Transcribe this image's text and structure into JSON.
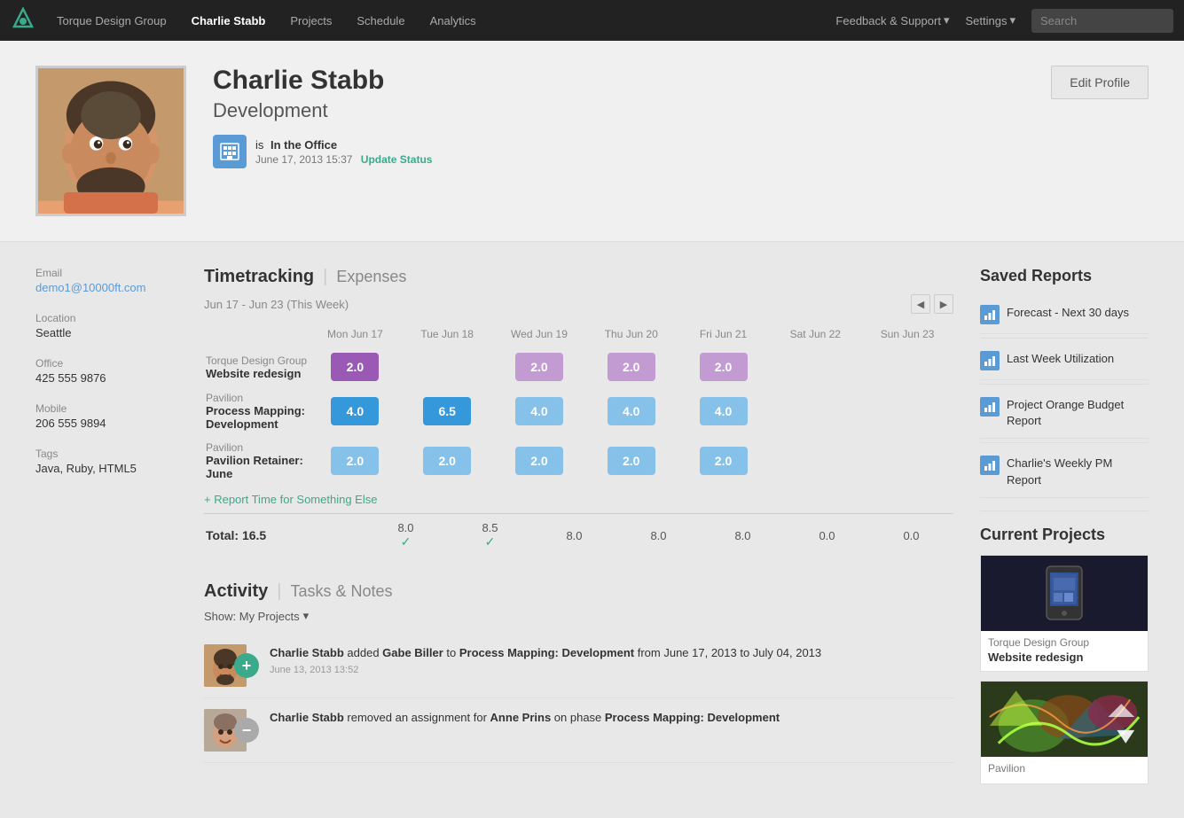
{
  "navbar": {
    "logo_label": "Torque Design Group Logo",
    "brand": "Torque Design Group",
    "nav_items": [
      {
        "label": "Torque Design Group",
        "active": false
      },
      {
        "label": "Charlie Stabb",
        "active": true
      },
      {
        "label": "Projects",
        "active": false
      },
      {
        "label": "Schedule",
        "active": false
      },
      {
        "label": "Analytics",
        "active": false
      }
    ],
    "feedback_label": "Feedback & Support",
    "settings_label": "Settings",
    "search_placeholder": "Search"
  },
  "profile": {
    "name": "Charlie Stabb",
    "department": "Development",
    "status_label": "is",
    "status": "In the Office",
    "timestamp": "June 17, 2013 15:37",
    "update_status_label": "Update Status",
    "edit_profile_label": "Edit Profile"
  },
  "contact": {
    "email_label": "Email",
    "email": "demo1@10000ft.com",
    "location_label": "Location",
    "location": "Seattle",
    "office_label": "Office",
    "office": "425 555 9876",
    "mobile_label": "Mobile",
    "mobile": "206 555 9894",
    "tags_label": "Tags",
    "tags": "Java, Ruby, HTML5"
  },
  "timetracking": {
    "title": "Timetracking",
    "expenses_tab": "Expenses",
    "week_range": "Jun 17 - Jun 23 (This Week)",
    "days": [
      {
        "name": "Mon",
        "date": "Jun 17"
      },
      {
        "name": "Tue",
        "date": "Jun 18"
      },
      {
        "name": "Wed",
        "date": "Jun 19"
      },
      {
        "name": "Thu",
        "date": "Jun 20"
      },
      {
        "name": "Fri",
        "date": "Jun 21"
      },
      {
        "name": "Sat",
        "date": "Jun 22"
      },
      {
        "name": "Sun",
        "date": "Jun 23"
      }
    ],
    "projects": [
      {
        "client": "Torque Design Group",
        "name": "Website redesign",
        "entries": [
          "2.0",
          "",
          "2.0",
          "2.0",
          "2.0",
          "",
          ""
        ],
        "style": [
          "purple",
          "empty",
          "purple-light",
          "purple-light",
          "purple-light",
          "empty",
          "empty"
        ]
      },
      {
        "client": "Pavilion",
        "name": "Process Mapping: Development",
        "entries": [
          "4.0",
          "6.5",
          "4.0",
          "4.0",
          "4.0",
          "",
          ""
        ],
        "style": [
          "blue",
          "blue",
          "blue-light",
          "blue-light",
          "blue-light",
          "empty",
          "empty"
        ]
      },
      {
        "client": "Pavilion",
        "name": "Pavilion Retainer: June",
        "entries": [
          "2.0",
          "2.0",
          "2.0",
          "2.0",
          "2.0",
          "",
          ""
        ],
        "style": [
          "blue-light",
          "blue-light",
          "blue-light",
          "blue-light",
          "blue-light",
          "empty",
          "empty"
        ]
      }
    ],
    "report_time_label": "+ Report Time for Something Else",
    "total_label": "Total: 16.5",
    "totals": [
      "8.0",
      "8.5",
      "8.0",
      "8.0",
      "8.0",
      "0.0",
      "0.0"
    ],
    "checks": [
      true,
      true,
      false,
      false,
      false,
      false,
      false
    ]
  },
  "activity": {
    "title": "Activity",
    "tasks_tab": "Tasks & Notes",
    "show_filter": "Show: My Projects",
    "items": [
      {
        "type": "add",
        "text_parts": [
          {
            "text": "Charlie Stabb",
            "bold": true
          },
          {
            "text": " added ",
            "bold": false
          },
          {
            "text": "Gabe Biller",
            "bold": true
          },
          {
            "text": " to ",
            "bold": false
          },
          {
            "text": "Process Mapping: Development",
            "bold": true
          },
          {
            "text": " from June 17, 2013 to July 04, 2013",
            "bold": false
          }
        ],
        "timestamp": "June 13, 2013 13:52"
      },
      {
        "type": "remove",
        "text_parts": [
          {
            "text": "Charlie Stabb",
            "bold": true
          },
          {
            "text": " removed an assignment for ",
            "bold": false
          },
          {
            "text": "Anne Prins",
            "bold": true
          },
          {
            "text": " on phase ",
            "bold": false
          },
          {
            "text": "Process Mapping: Development",
            "bold": true
          }
        ],
        "timestamp": ""
      }
    ]
  },
  "saved_reports": {
    "title": "Saved Reports",
    "items": [
      {
        "name": "Forecast - Next 30 days"
      },
      {
        "name": "Last Week Utilization"
      },
      {
        "name": "Project Orange Budget Report"
      },
      {
        "name": "Charlie's Weekly PM Report"
      }
    ]
  },
  "current_projects": {
    "title": "Current Projects",
    "items": [
      {
        "client": "Torque Design Group",
        "name": "Website redesign",
        "color": "#1a1a2e"
      },
      {
        "client": "Pavilion",
        "name": "",
        "color": "#4a7a4a"
      }
    ]
  }
}
